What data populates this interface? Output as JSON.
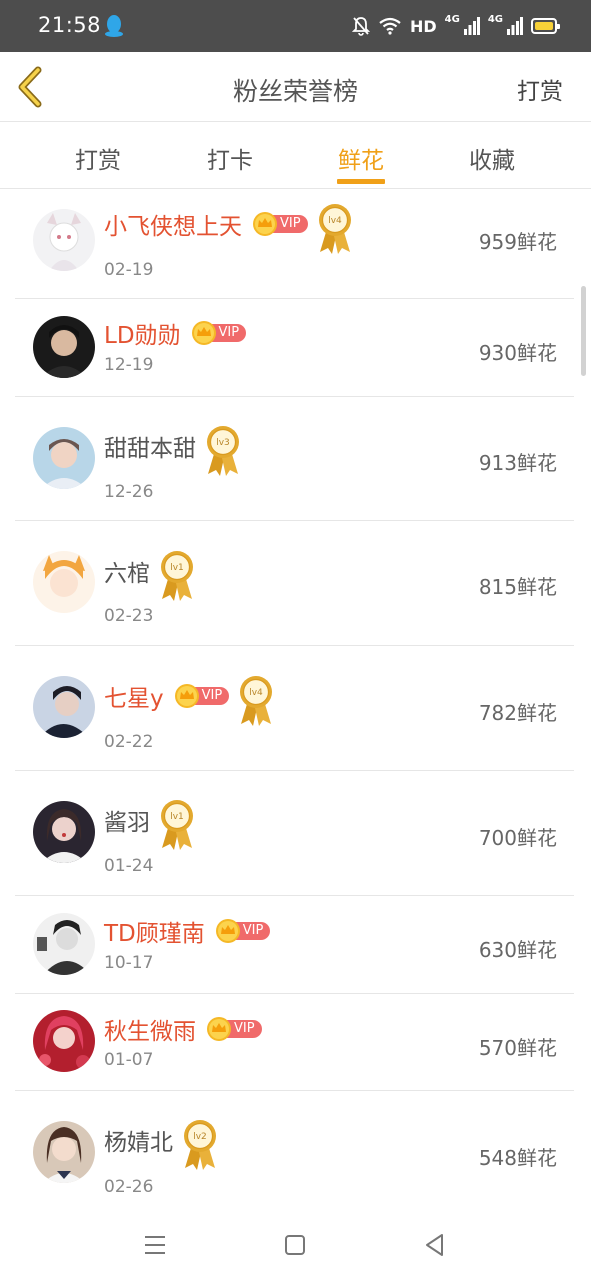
{
  "status_bar": {
    "time": "21:58",
    "signal_label": "HD",
    "network_1": "4G",
    "network_2": "4G",
    "icons": [
      "qq-icon",
      "mute-bell-icon",
      "wifi-icon",
      "signal-icon",
      "battery-icon"
    ],
    "battery_color": "#f7d138"
  },
  "header": {
    "title": "粉丝荣誉榜",
    "action": "打赏",
    "back_icon": "chevron-left-icon"
  },
  "tabs": [
    {
      "label": "打赏",
      "active": false
    },
    {
      "label": "打卡",
      "active": false
    },
    {
      "label": "鲜花",
      "active": true
    },
    {
      "label": "收藏",
      "active": false
    }
  ],
  "colors": {
    "accent": "#f0a018",
    "vip_name": "#e35231",
    "vip_badge": "#f06a6a",
    "status_bar_bg": "#4d4d4d"
  },
  "ranking": [
    {
      "name": "小飞侠想上天",
      "vip": true,
      "level": "lv4",
      "date": "02-19",
      "count": "959鲜花"
    },
    {
      "name": "LD勋勋",
      "vip": true,
      "level": "",
      "date": "12-19",
      "count": "930鲜花"
    },
    {
      "name": "甜甜本甜",
      "vip": false,
      "level": "lv3",
      "date": "12-26",
      "count": "913鲜花"
    },
    {
      "name": "六棺",
      "vip": false,
      "level": "lv1",
      "date": "02-23",
      "count": "815鲜花"
    },
    {
      "name": "七星y",
      "vip": true,
      "level": "lv4",
      "date": "02-22",
      "count": "782鲜花"
    },
    {
      "name": "酱羽",
      "vip": false,
      "level": "lv1",
      "date": "01-24",
      "count": "700鲜花"
    },
    {
      "name": "TD顾瑾南",
      "vip": true,
      "level": "",
      "date": "10-17",
      "count": "630鲜花"
    },
    {
      "name": "秋生微雨",
      "vip": true,
      "level": "",
      "date": "01-07",
      "count": "570鲜花"
    },
    {
      "name": "杨婧北",
      "vip": false,
      "level": "lv2",
      "date": "02-26",
      "count": "548鲜花"
    }
  ],
  "vip_label": "VIP",
  "nav_bar": {
    "icons": [
      "menu-icon",
      "home-icon",
      "back-triangle-icon"
    ]
  }
}
